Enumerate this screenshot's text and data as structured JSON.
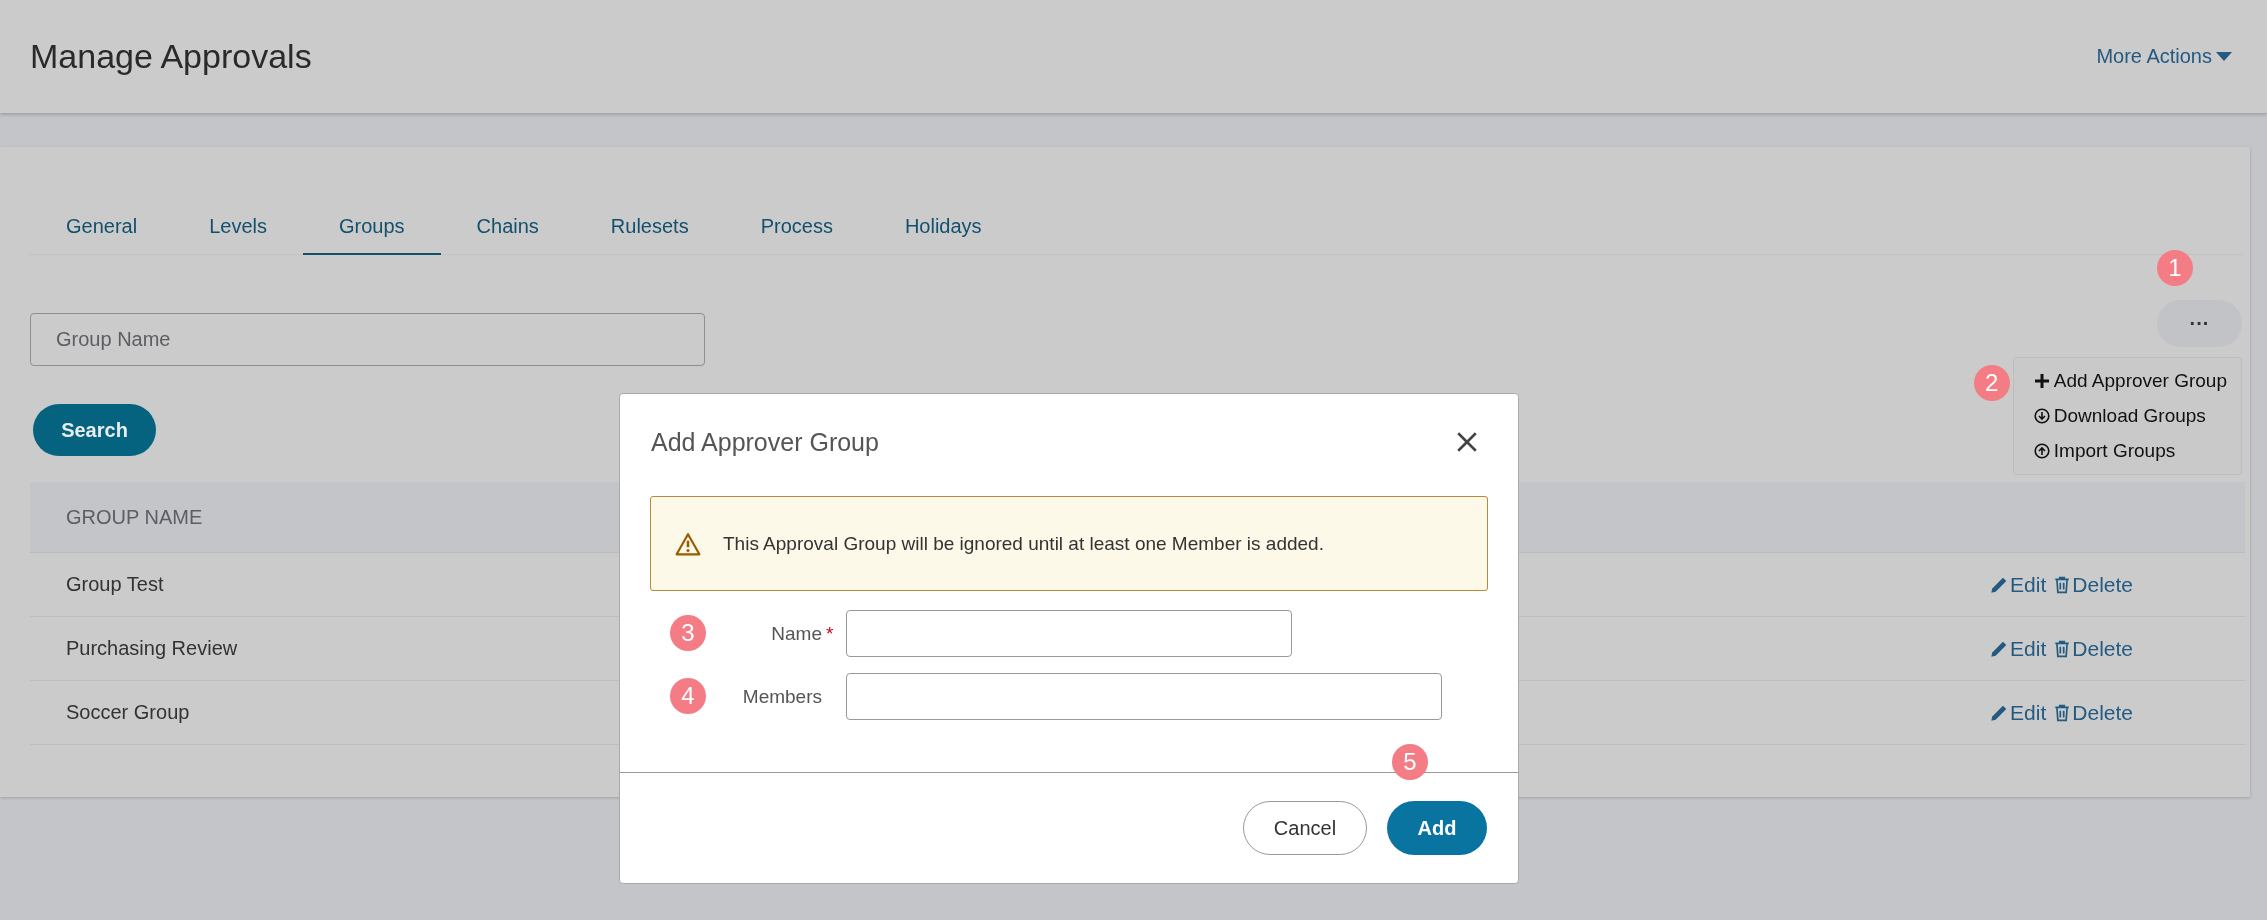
{
  "header": {
    "title": "Manage Approvals",
    "more_actions": "More Actions"
  },
  "tabs": [
    {
      "label": "General",
      "selected": false
    },
    {
      "label": "Levels",
      "selected": false
    },
    {
      "label": "Groups",
      "selected": true
    },
    {
      "label": "Chains",
      "selected": false
    },
    {
      "label": "Rulesets",
      "selected": false
    },
    {
      "label": "Process",
      "selected": false
    },
    {
      "label": "Holidays",
      "selected": false
    }
  ],
  "search": {
    "placeholder": "Group Name",
    "button": "Search"
  },
  "more_button": {
    "label": "···",
    "badge": "1"
  },
  "menu": {
    "badge": "2",
    "items": [
      {
        "label": "Add Approver Group",
        "kind": "add"
      },
      {
        "label": "Download Groups",
        "kind": "download"
      },
      {
        "label": "Import Groups",
        "kind": "import"
      }
    ]
  },
  "table": {
    "columns": [
      "GROUP NAME"
    ],
    "rows": [
      {
        "name": "Group Test",
        "actions": [
          "Edit",
          "Delete"
        ]
      },
      {
        "name": "Purchasing Review",
        "actions": [
          "Edit",
          "Delete"
        ]
      },
      {
        "name": "Soccer Group",
        "actions": [
          "Edit",
          "Delete"
        ]
      }
    ]
  },
  "dialog": {
    "title": "Add Approver Group",
    "alert": "This Approval Group will be ignored until at least one Member is added.",
    "fields": [
      {
        "label": "Name",
        "required_mark": "*",
        "badge": "3"
      },
      {
        "label": "Members",
        "badge": "4"
      }
    ],
    "buttons": [
      {
        "label": "Cancel",
        "kind": "secondary"
      },
      {
        "label": "Add",
        "kind": "primary",
        "badge": "5"
      }
    ]
  }
}
